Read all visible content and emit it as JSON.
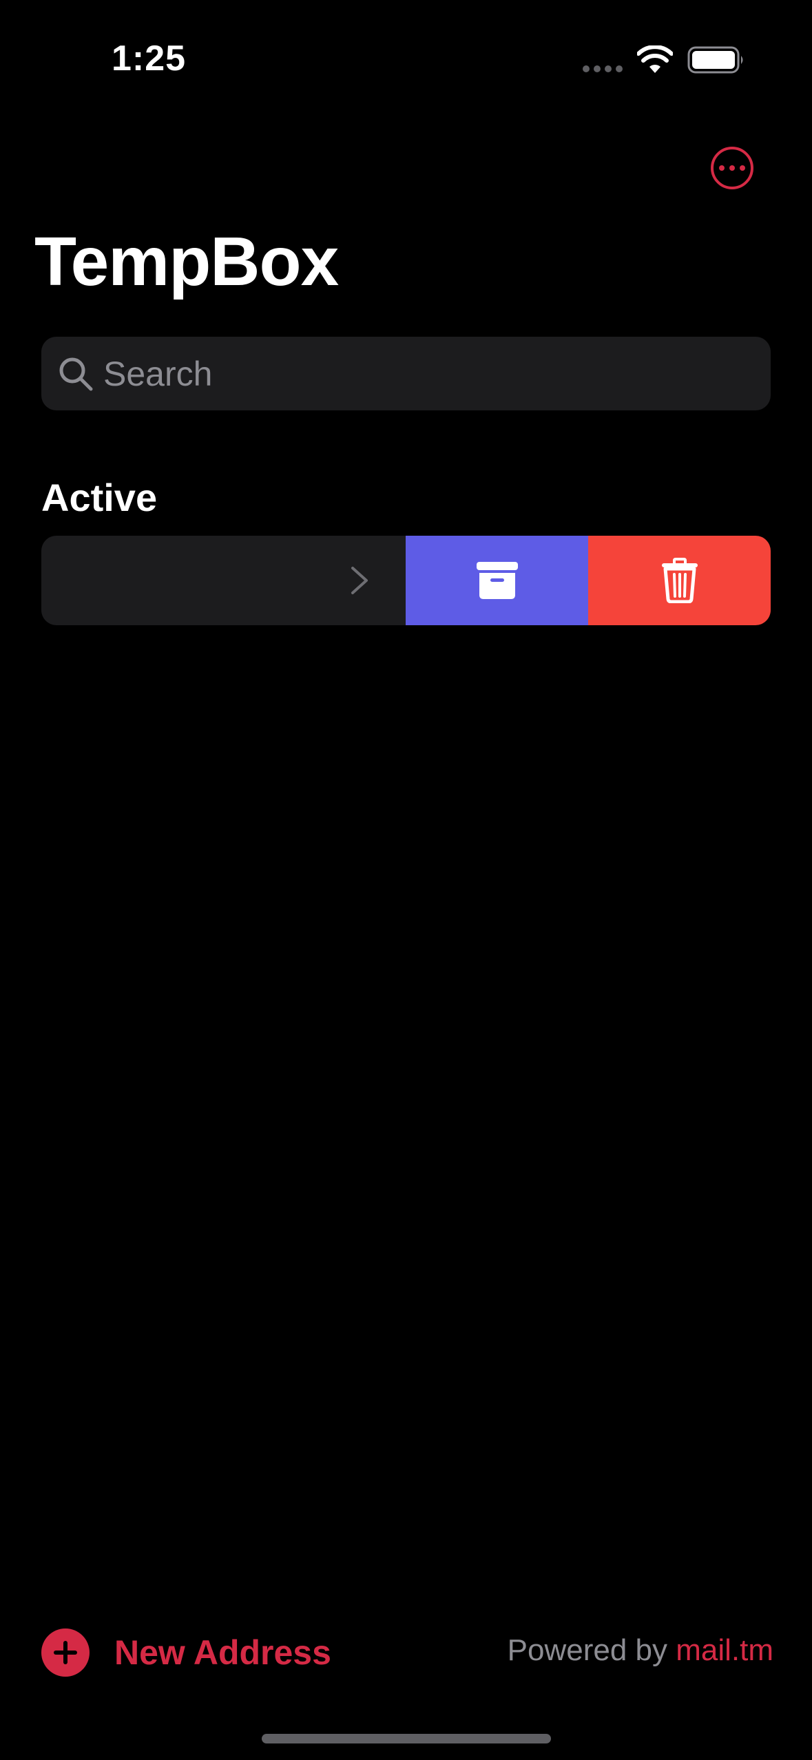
{
  "status_bar": {
    "time": "1:25"
  },
  "header": {
    "title": "TempBox"
  },
  "search": {
    "placeholder": "Search",
    "value": ""
  },
  "sections": [
    {
      "title": "Active"
    }
  ],
  "footer": {
    "new_address_label": "New Address",
    "powered_prefix": "Powered by ",
    "powered_link": "mail.tm"
  },
  "icons": {
    "more": "ellipsis-circle-icon",
    "search": "magnifying-glass-icon",
    "chevron": "chevron-right-icon",
    "archive": "archive-box-icon",
    "delete": "trash-icon",
    "add": "plus-circle-icon"
  },
  "colors": {
    "background": "#000000",
    "accent": "#d52a45",
    "archive": "#5e5ce6",
    "delete": "#f5443a",
    "row": "#1c1c1e",
    "secondary_text": "#8d8d93"
  }
}
